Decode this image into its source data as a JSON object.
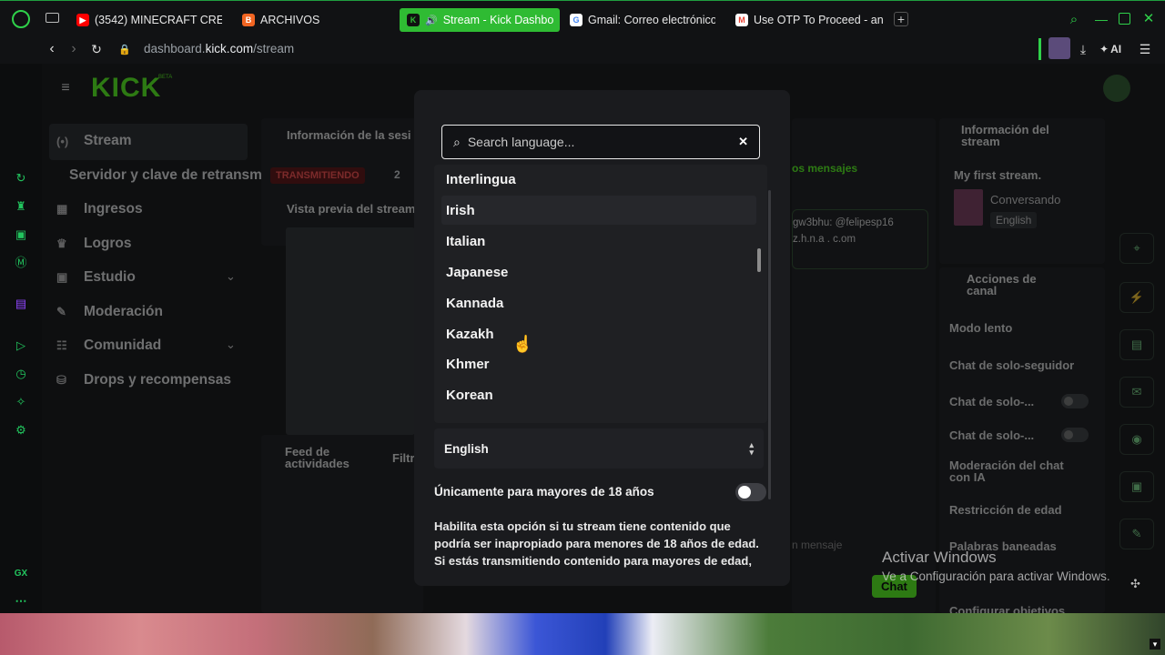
{
  "browser": {
    "tabs": [
      {
        "title": "(3542) MINECRAFT CREE",
        "icon": "youtube-icon",
        "color": "#ff0000"
      },
      {
        "title": "ARCHIVOS",
        "icon": "blogger-icon",
        "color": "#f26522"
      },
      {
        "title": "Stream - Kick Dashbo",
        "icon": "kick-icon",
        "color": "#2fbb33"
      },
      {
        "title": "Gmail: Correo electrónico",
        "icon": "google-icon",
        "color": "#4285f4"
      },
      {
        "title": "Use OTP To Proceed - and",
        "icon": "gmail-icon",
        "color": "#ea4335"
      }
    ],
    "url_prefix": "dashboard.",
    "url_domain": "kick.com",
    "url_path": "/stream",
    "ai_label": "AI",
    "gx_label": "GX"
  },
  "dashboard": {
    "logo": "KICK",
    "logo_badge": "BETA",
    "nav": [
      {
        "label": "Stream",
        "icon": "stream-icon"
      },
      {
        "label": "Servidor y clave de retransm",
        "icon": ""
      },
      {
        "label": "Ingresos",
        "icon": "revenue-icon"
      },
      {
        "label": "Logros",
        "icon": "trophy-icon"
      },
      {
        "label": "Estudio",
        "icon": "studio-icon"
      },
      {
        "label": "Moderación",
        "icon": "wrench-icon"
      },
      {
        "label": "Comunidad",
        "icon": "community-icon"
      },
      {
        "label": "Drops y recompensas",
        "icon": "drops-icon"
      }
    ],
    "session_title": "Información de la sesi",
    "live_badge": "TRANSMITIENDO",
    "live_count": "2",
    "preview_title": "Vista previa del stream",
    "activity_title": "Feed de actividades",
    "filter_label": "Filtr",
    "chat_heading": "os mensajes",
    "chat_line1": "gw3bhu: @felipesp16",
    "chat_line2": "z.h.n.a . c.om",
    "chat_placeholder": "n mensaje",
    "chat_button": "Chat",
    "stream_info_title": "Información del stream",
    "stream_name": "My first stream.",
    "stream_category": "Conversando",
    "stream_lang": "English",
    "channel_actions_title": "Acciones de canal",
    "channel_actions": [
      "Modo lento",
      "Chat de solo-seguidor",
      "Chat de solo-...",
      "Chat de solo-...",
      "Moderación del chat con IA",
      "Restricción de edad",
      "Palabras baneadas",
      "Configurar objetivos"
    ]
  },
  "modal": {
    "search_placeholder": "Search language...",
    "languages": [
      "Interlingua",
      "Irish",
      "Italian",
      "Japanese",
      "Kannada",
      "Kazakh",
      "Khmer",
      "Korean"
    ],
    "highlighted": "Irish",
    "selected_language": "English",
    "adult_label": "Únicamente para mayores de 18 años",
    "adult_enabled": false,
    "description": "Habilita esta opción si tu stream tiene contenido que podría ser inapropiado para menores de 18 años de edad. Si estás transmitiendo contenido para mayores de edad,"
  },
  "windows_watermark": {
    "line1": "Activar Windows",
    "line2": "Ve a Configuración para activar Windows."
  }
}
